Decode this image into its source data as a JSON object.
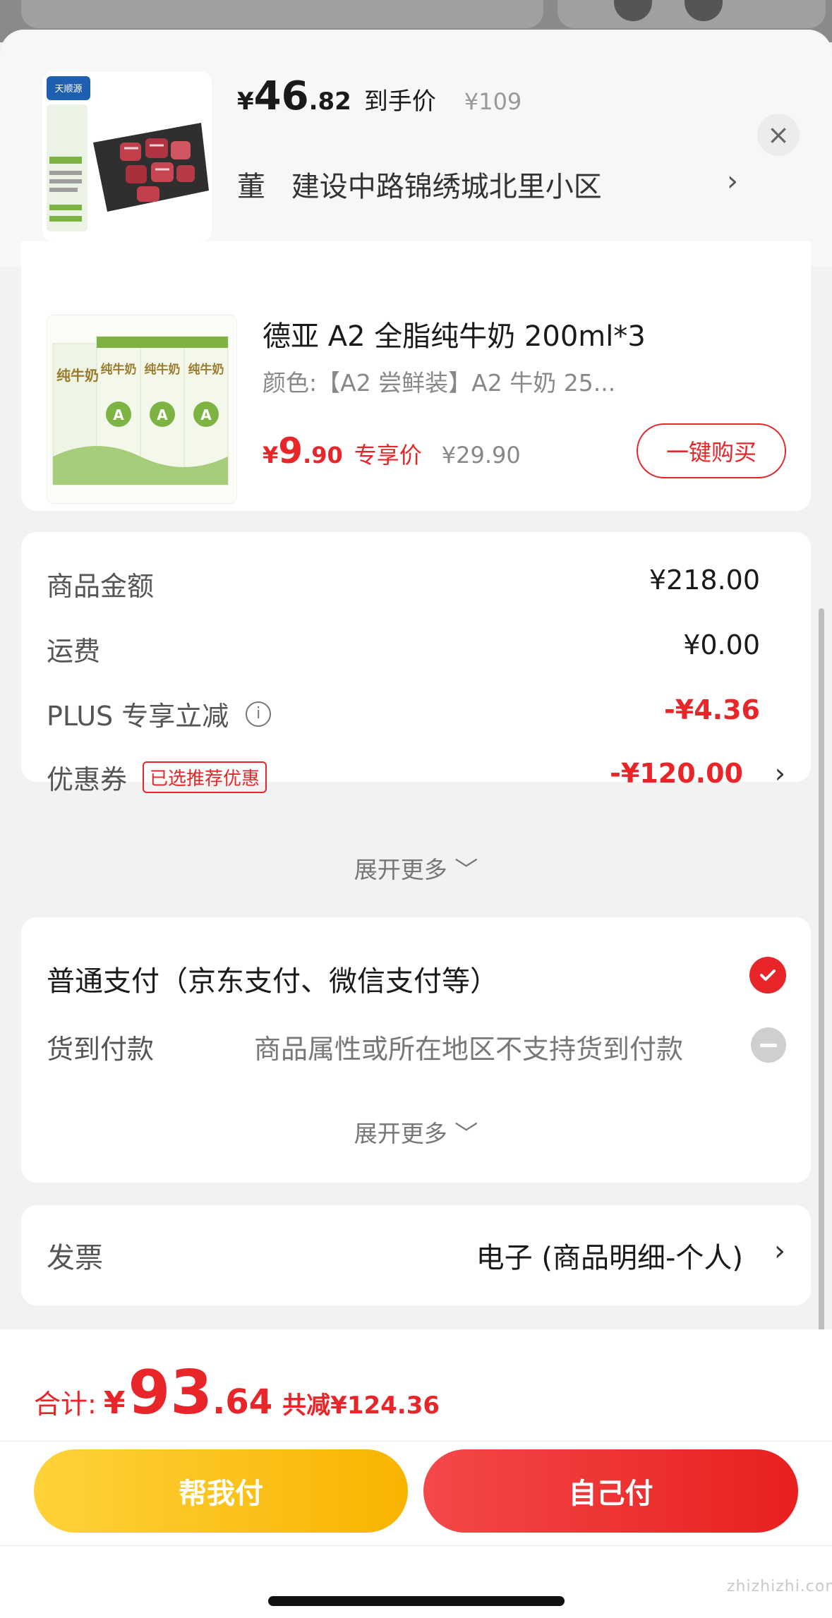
{
  "header": {
    "currency": "¥",
    "price_int": "46",
    "price_dec": ".82",
    "price_tag": "到手价",
    "original_price": "¥109",
    "recipient": "董",
    "address": "建设中路锦绣城北里小区",
    "address_chevron": "›",
    "close_label": "×",
    "brand_logo_text": "pure source 天顺源"
  },
  "product": {
    "title": "德亚 A2 全脂纯牛奶 200ml*3",
    "spec": "颜色:【A2 尝鲜装】A2 牛奶 25...",
    "currency": "¥",
    "price_int": "9",
    "price_dec": ".90",
    "price_tag": "专享价",
    "original_price": "¥29.90",
    "buy_label": "一键购买",
    "thumb_text": "纯牛奶"
  },
  "amounts": {
    "rows": [
      {
        "label": "商品金额",
        "value": "¥218.00"
      },
      {
        "label": "运费",
        "value": "¥0.00"
      },
      {
        "label": "PLUS 专享立减",
        "value": "-¥4.36"
      },
      {
        "label": "优惠券",
        "badge": "已选推荐优惠",
        "value": "-¥120.00"
      }
    ],
    "expand_label": "展开更多 ﹀",
    "info_icon": "i",
    "chevron": "›"
  },
  "payment": {
    "option1": "普通支付（京东支付、微信支付等）",
    "option2_label": "货到付款",
    "option2_note": "商品属性或所在地区不支持货到付款",
    "expand_label": "展开更多 ﹀"
  },
  "invoice": {
    "label": "发票",
    "value": "电子 (商品明细-个人)",
    "chevron": "›"
  },
  "footer": {
    "total_label": "合计:",
    "currency": "¥",
    "total_int": "93",
    "total_dec": ".64",
    "saved": "共减¥124.36",
    "help_pay": "帮我付",
    "self_pay": "自己付"
  },
  "watermark": "zhizhizhi.com",
  "colors": {
    "accent_red": "#e8262a",
    "help_button_yellow": "#f8b400"
  }
}
